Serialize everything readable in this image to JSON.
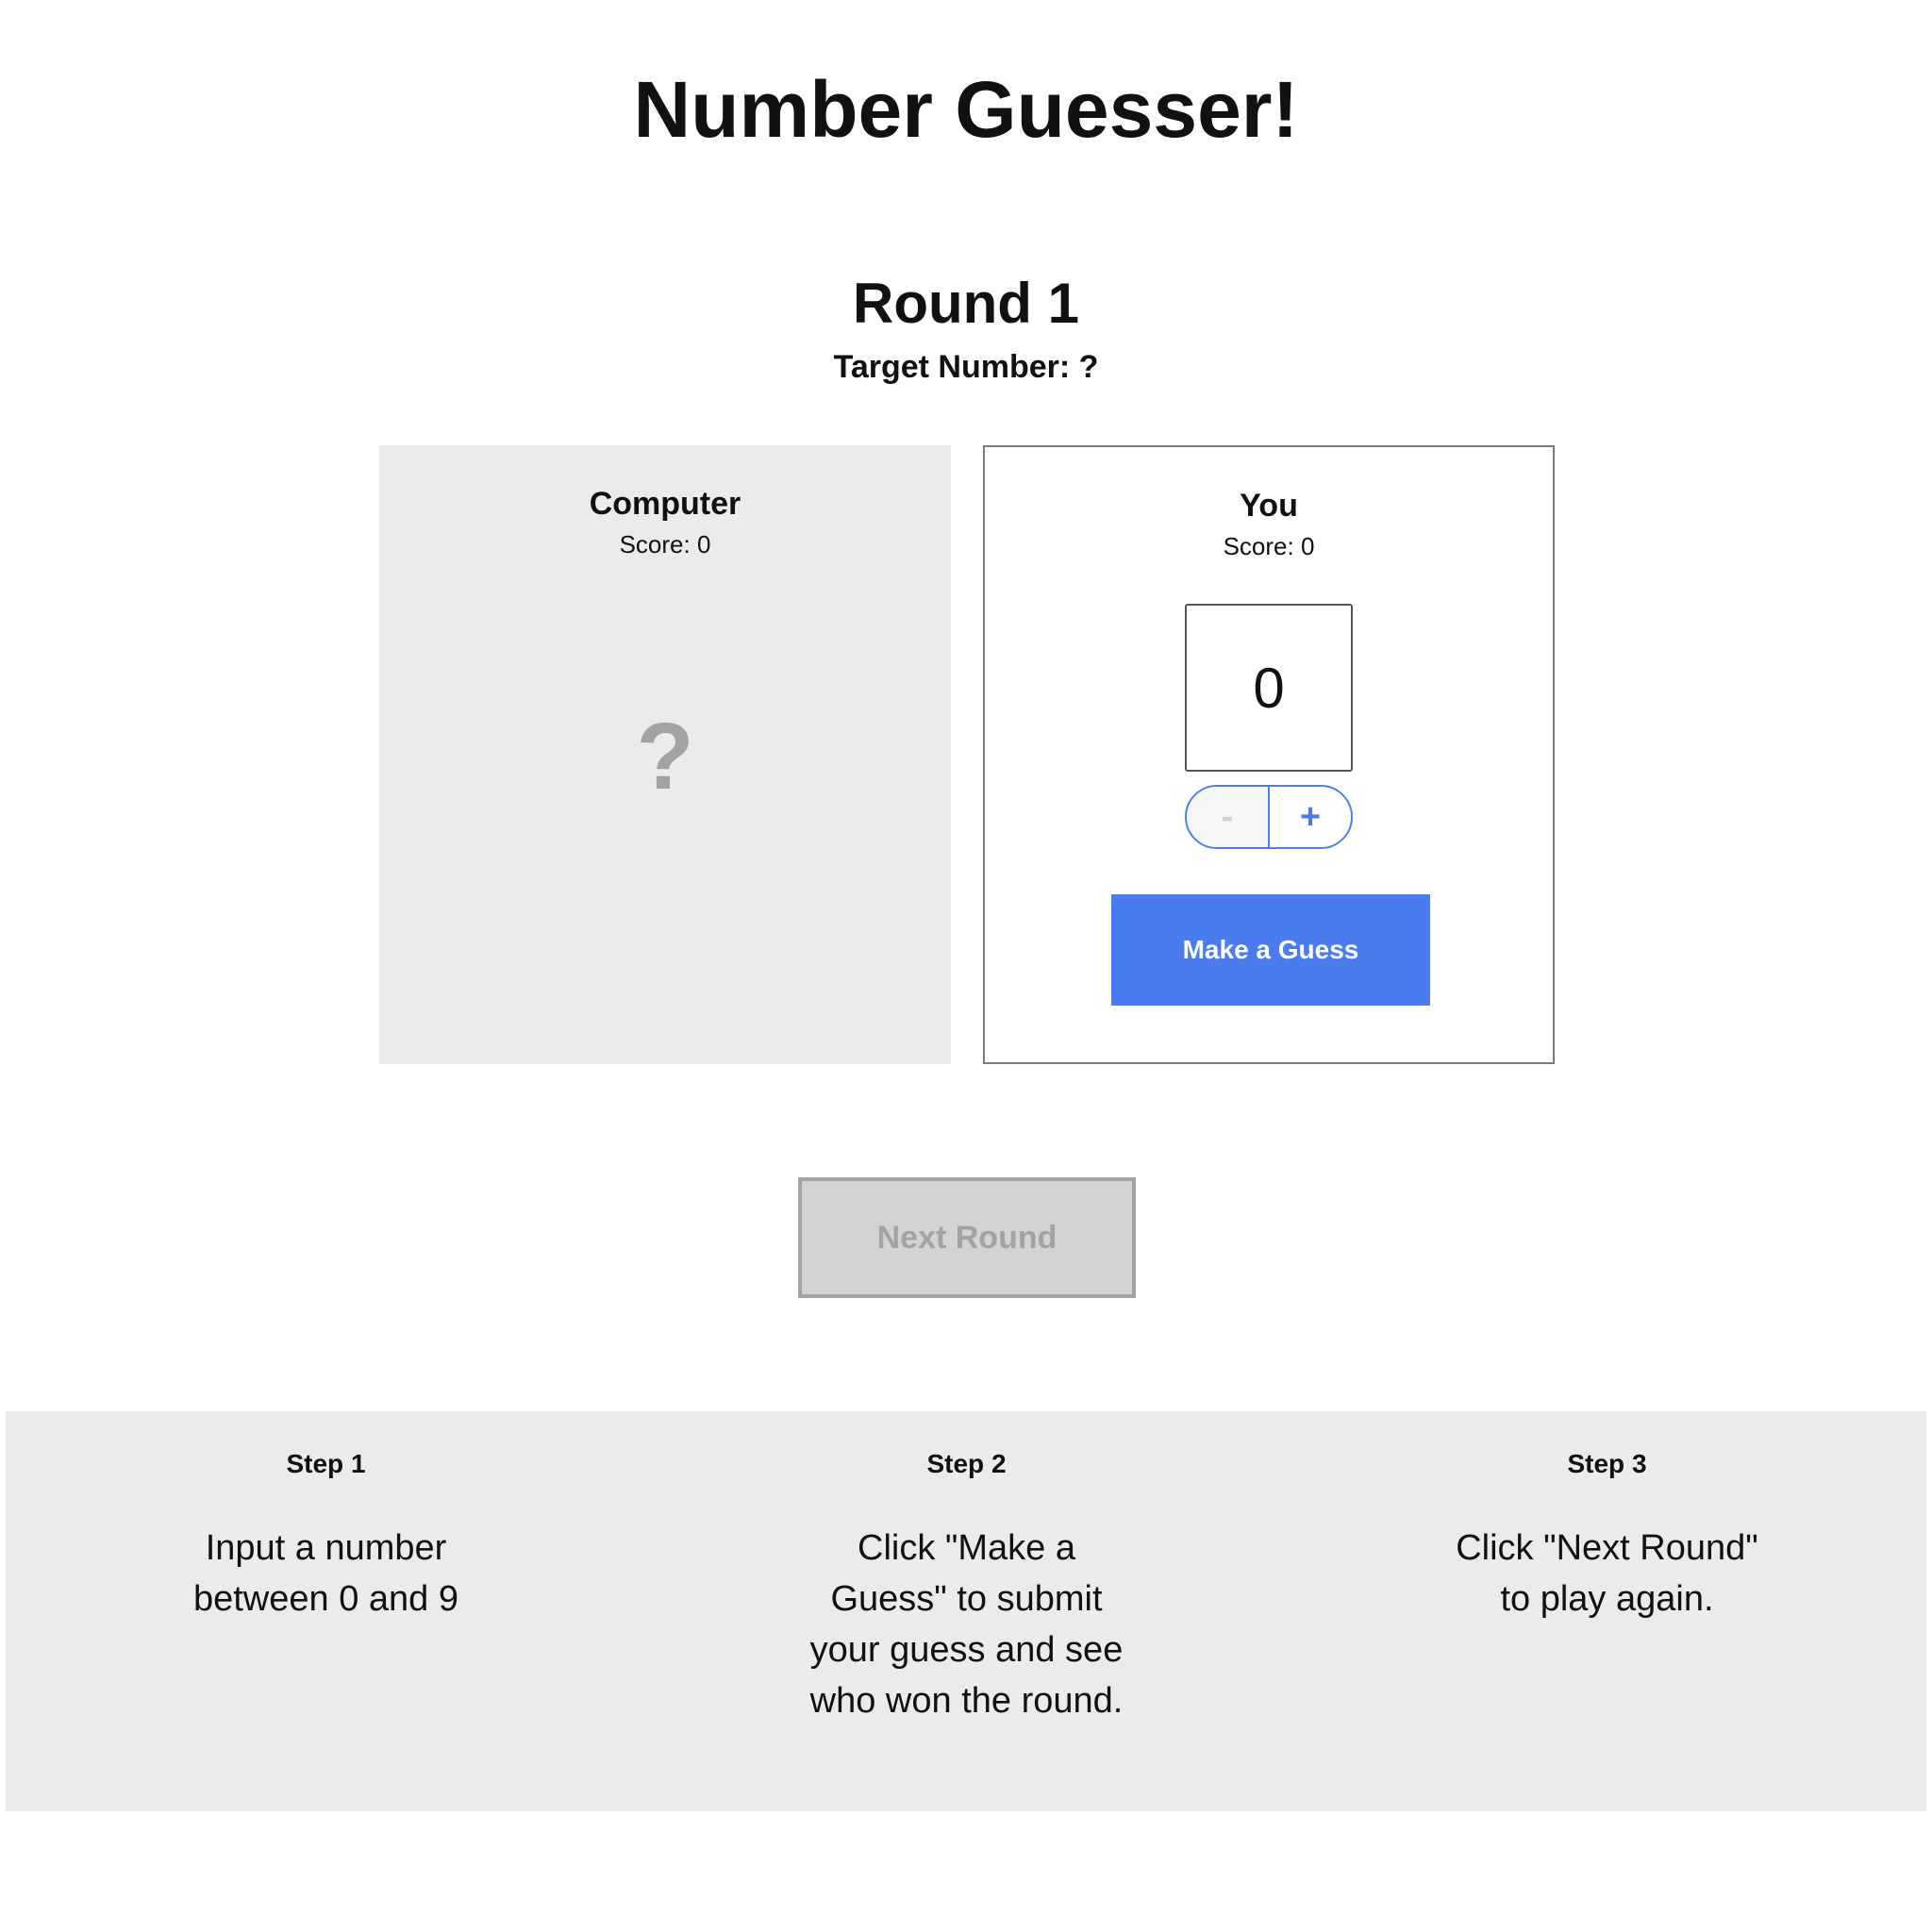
{
  "header": {
    "title": "Number Guesser!"
  },
  "round": {
    "title": "Round 1",
    "target_label": "Target Number: ?"
  },
  "computer": {
    "name": "Computer",
    "score": "Score: 0",
    "guess": "?"
  },
  "player": {
    "name": "You",
    "score": "Score: 0",
    "guess_value": "0",
    "decrease_label": "-",
    "increase_label": "+",
    "guess_button_label": "Make a Guess"
  },
  "controls": {
    "next_round_label": "Next Round",
    "next_round_disabled": true
  },
  "colors": {
    "accent": "#4a7cf0",
    "panel_gray": "#ebebeb",
    "disabled_text": "#a3a3a3",
    "disabled_bg": "#d3d3d3"
  },
  "steps": [
    {
      "title": "Step 1",
      "text": "Input a number between 0 and 9"
    },
    {
      "title": "Step 2",
      "text": "Click \"Make a Guess\" to submit your guess and see who won the round."
    },
    {
      "title": "Step 3",
      "text": "Click \"Next Round\" to play again."
    }
  ]
}
